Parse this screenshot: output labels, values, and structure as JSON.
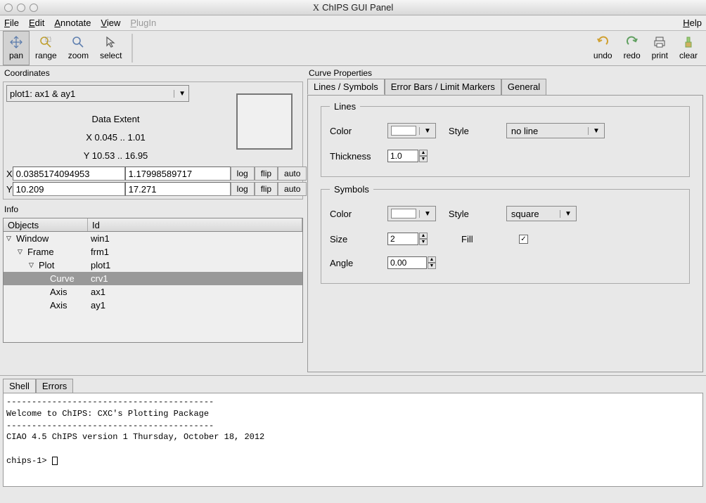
{
  "window": {
    "title": "ChIPS GUI Panel",
    "system_prefix": "X"
  },
  "menubar": {
    "file": "File",
    "edit": "Edit",
    "annotate": "Annotate",
    "view": "View",
    "plugin": "PlugIn",
    "help": "Help"
  },
  "toolbar": {
    "pan": "pan",
    "range": "range",
    "zoom": "zoom",
    "select": "select",
    "undo": "undo",
    "redo": "redo",
    "print": "print",
    "clear": "clear"
  },
  "coordinates": {
    "label": "Coordinates",
    "selector": "plot1: ax1 & ay1",
    "data_extent_title": "Data Extent",
    "x_extent": "X 0.045 .. 1.01",
    "y_extent": "Y 10.53 .. 16.95",
    "x_label": "X",
    "x_min": "0.0385174094953",
    "x_max": "1.17998589717",
    "y_label": "Y",
    "y_min": "10.209",
    "y_max": "17.271",
    "log_btn": "log",
    "flip_btn": "flip",
    "auto_btn": "auto"
  },
  "info": {
    "label": "Info",
    "col_objects": "Objects",
    "col_id": "Id",
    "rows": [
      {
        "indent": 0,
        "obj": "Window",
        "id": "win1"
      },
      {
        "indent": 1,
        "obj": "Frame",
        "id": "frm1"
      },
      {
        "indent": 2,
        "obj": "Plot",
        "id": "plot1"
      },
      {
        "indent": 3,
        "obj": "Curve",
        "id": "crv1",
        "selected": true
      },
      {
        "indent": 3,
        "obj": "Axis",
        "id": "ax1"
      },
      {
        "indent": 3,
        "obj": "Axis",
        "id": "ay1"
      }
    ]
  },
  "properties": {
    "label": "Curve Properties",
    "tabs": {
      "lines_symbols": "Lines / Symbols",
      "error_bars": "Error Bars / Limit Markers",
      "general": "General"
    },
    "lines_legend": "Lines",
    "symbols_legend": "Symbols",
    "field": {
      "color": "Color",
      "style": "Style",
      "thickness": "Thickness",
      "size": "Size",
      "fill": "Fill",
      "angle": "Angle"
    },
    "values": {
      "line_style": "no line",
      "thickness": "1.0",
      "symbol_style": "square",
      "symbol_size": "2",
      "symbol_fill": true,
      "angle": "0.00"
    }
  },
  "shell": {
    "tab_shell": "Shell",
    "tab_errors": "Errors",
    "line_sep": "-----------------------------------------",
    "welcome": "Welcome to ChIPS: CXC's Plotting Package",
    "version": "CIAO 4.5 ChIPS version 1 Thursday, October 18, 2012",
    "prompt": "chips-1>"
  }
}
